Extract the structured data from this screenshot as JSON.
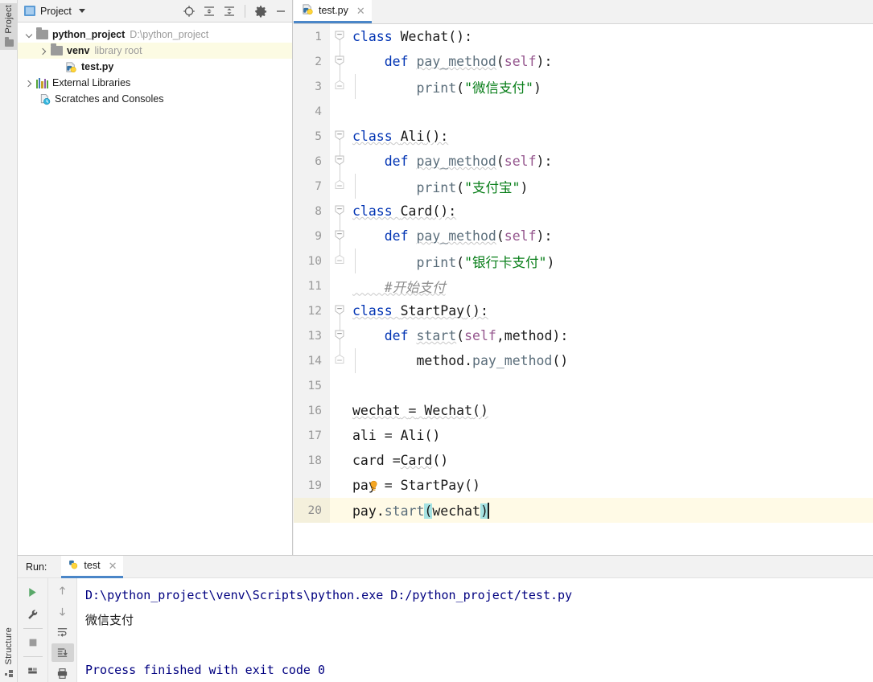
{
  "window": {
    "left_tool_tabs": [
      {
        "label": "Project",
        "icon": "folder-icon",
        "active": true
      },
      {
        "label": "Structure",
        "icon": "structure-grid-icon",
        "active": false
      }
    ]
  },
  "project_panel": {
    "title": "Project",
    "title_icon": "project-view-icon",
    "dropdown_icon": "chevron-down-icon",
    "toolbar": [
      {
        "name": "locate-icon",
        "title": "Select Opened File"
      },
      {
        "name": "expand-all-icon",
        "title": "Expand All"
      },
      {
        "name": "collapse-all-icon",
        "title": "Collapse All"
      },
      {
        "name": "gear-icon",
        "title": "Settings"
      },
      {
        "name": "minimize-icon",
        "title": "Hide"
      }
    ],
    "tree": [
      {
        "label": "python_project",
        "suffix": "D:\\python_project",
        "icon": "folder-icon",
        "arrow": "down",
        "indent": 0,
        "bold": true,
        "selected": false
      },
      {
        "label": "venv",
        "suffix": "library root",
        "icon": "folder-icon",
        "arrow": "right",
        "indent": 1,
        "bold": true,
        "selected": true
      },
      {
        "label": "test.py",
        "suffix": "",
        "icon": "python-file-icon",
        "arrow": "none",
        "indent": 2,
        "bold": true,
        "selected": false
      },
      {
        "label": "External Libraries",
        "suffix": "",
        "icon": "libraries-icon",
        "arrow": "right",
        "indent": 0,
        "bold": false,
        "selected": false
      },
      {
        "label": "Scratches and Consoles",
        "suffix": "",
        "icon": "scratches-icon",
        "arrow": "none",
        "indent": 1,
        "bold": false,
        "selected": false
      }
    ]
  },
  "editor": {
    "tabs": [
      {
        "label": "test.py",
        "icon": "python-file-icon",
        "close_icon": "close-icon",
        "active": true
      }
    ],
    "current_line": 20,
    "lines": [
      {
        "n": 1,
        "fold": "open",
        "text": "class Wechat():"
      },
      {
        "n": 2,
        "fold": "open",
        "text": "    def pay_method(self):"
      },
      {
        "n": 3,
        "fold": "end",
        "text": "        print(\"微信支付\")"
      },
      {
        "n": 4,
        "fold": "none",
        "text": ""
      },
      {
        "n": 5,
        "fold": "open",
        "text": "class Ali():"
      },
      {
        "n": 6,
        "fold": "open",
        "text": "    def pay_method(self):"
      },
      {
        "n": 7,
        "fold": "end",
        "text": "        print(\"支付宝\")"
      },
      {
        "n": 8,
        "fold": "open",
        "text": "class Card():"
      },
      {
        "n": 9,
        "fold": "open",
        "text": "    def pay_method(self):"
      },
      {
        "n": 10,
        "fold": "end",
        "text": "        print(\"银行卡支付\")"
      },
      {
        "n": 11,
        "fold": "none",
        "text": "    #开始支付"
      },
      {
        "n": 12,
        "fold": "open",
        "text": "class StartPay():"
      },
      {
        "n": 13,
        "fold": "open",
        "text": "    def start(self,method):"
      },
      {
        "n": 14,
        "fold": "end",
        "text": "        method.pay_method()"
      },
      {
        "n": 15,
        "fold": "none",
        "text": ""
      },
      {
        "n": 16,
        "fold": "none",
        "text": "wechat = Wechat()"
      },
      {
        "n": 17,
        "fold": "none",
        "text": "ali = Ali()"
      },
      {
        "n": 18,
        "fold": "none",
        "text": "card =Card()"
      },
      {
        "n": 19,
        "fold": "none",
        "text": "pay = StartPay()"
      },
      {
        "n": 20,
        "fold": "none",
        "text": "pay.start(wechat)"
      }
    ],
    "intention_bulb": {
      "name": "intention-bulb-icon",
      "line": 19
    },
    "colors": {
      "keyword": "#0033b3",
      "string": "#067d17",
      "self_param": "#94558d",
      "function": "#5a6d7a",
      "comment": "#8c8c8c",
      "current_line_bg": "#fffae6",
      "paren_match_bg": "#a5e2e2",
      "tab_underline": "#4a86c8"
    }
  },
  "run_panel": {
    "label": "Run:",
    "tab": {
      "label": "test",
      "icon": "python-file-icon",
      "close_icon": "close-icon"
    },
    "tools_left": [
      {
        "name": "run-icon",
        "title": "Rerun",
        "active": false
      },
      {
        "name": "wrench-icon",
        "title": "Edit Configuration",
        "active": false
      },
      {
        "name": "stop-icon",
        "title": "Stop",
        "active": false
      },
      {
        "name": "layout-icon",
        "title": "Layout",
        "active": false
      }
    ],
    "tools_right": [
      {
        "name": "arrow-up-icon",
        "title": "Up the stack trace",
        "active": false
      },
      {
        "name": "arrow-down-icon",
        "title": "Down the stack trace",
        "active": false
      },
      {
        "name": "soft-wrap-icon",
        "title": "Soft-Wrap",
        "active": false
      },
      {
        "name": "scroll-to-end-icon",
        "title": "Scroll to End",
        "active": true
      },
      {
        "name": "print-icon",
        "title": "Print",
        "active": false
      }
    ],
    "console_lines": [
      {
        "text": "D:\\python_project\\venv\\Scripts\\python.exe D:/python_project/test.py",
        "style": "path"
      },
      {
        "text": "微信支付",
        "style": "output"
      },
      {
        "text": "",
        "style": "blank"
      },
      {
        "text": "",
        "style": "blank"
      },
      {
        "text": "Process finished with exit code 0",
        "style": "path"
      }
    ]
  }
}
